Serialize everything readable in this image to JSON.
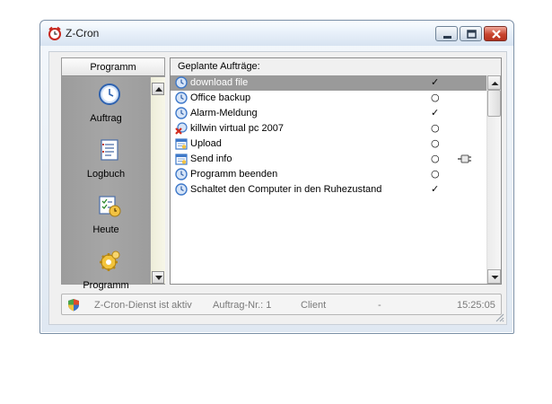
{
  "window": {
    "title": "Z-Cron"
  },
  "nav": {
    "header": "Programm",
    "items": [
      {
        "label": "Auftrag",
        "icon": "clock-icon"
      },
      {
        "label": "Logbuch",
        "icon": "logbook-icon"
      },
      {
        "label": "Heute",
        "icon": "today-calendar-icon"
      },
      {
        "label": "Programm",
        "icon": "gear-icon"
      }
    ]
  },
  "tasks": {
    "header": "Geplante Aufträge:",
    "rows": [
      {
        "name": "download file",
        "icon": "clock-icon",
        "state": "✓",
        "selected": true
      },
      {
        "name": "Office backup",
        "icon": "clock-icon",
        "state": "○"
      },
      {
        "name": "Alarm-Meldung",
        "icon": "clock-icon",
        "state": "✓"
      },
      {
        "name": "killwin virtual pc 2007",
        "icon": "error-clock-icon",
        "state": "○"
      },
      {
        "name": "Upload",
        "icon": "calendar-icon",
        "state": "○"
      },
      {
        "name": "Send info",
        "icon": "calendar-icon",
        "state": "○",
        "extra": "plug-icon"
      },
      {
        "name": "Programm beenden",
        "icon": "clock-icon",
        "state": "○"
      },
      {
        "name": "Schaltet den Computer in den Ruhezustand",
        "icon": "clock-icon",
        "state": "✓"
      }
    ]
  },
  "status": {
    "service": "Z-Cron-Dienst ist aktiv",
    "job": "Auftrag-Nr.: 1",
    "mode": "Client",
    "separator": "-",
    "time": "15:25:05"
  },
  "colors": {
    "selection": "#9a9a9a",
    "nav_bg": "#a3a3a3",
    "close_red": "#c9442f",
    "clock_blue": "#3e78c9"
  }
}
